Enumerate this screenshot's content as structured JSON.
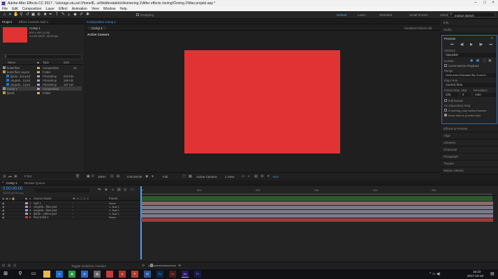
{
  "window": {
    "title": "Adobe After Effects CC 2017 - \\\\storage.stu.sel.\\Home$\\...a\\Webbredaktör\\Animering 2\\After effects övning\\Övning 2\\Mas projekt.aep *"
  },
  "menu": [
    "File",
    "Edit",
    "Composition",
    "Layer",
    "Effect",
    "Animation",
    "View",
    "Window",
    "Help"
  ],
  "toolbar": {
    "snapping_label": "Snapping",
    "workspaces": [
      "Default",
      "Learn",
      "Standard",
      "Small Screen",
      "Libraries"
    ],
    "search_value": "motion sketch"
  },
  "project": {
    "tab_project": "Project",
    "tab_effect_controls": "Effect Controls Null 1",
    "comp_name": "Comp 1",
    "comp_info_1": "600 x 400 (1,00)",
    "comp_info_2": "Δ 0:00:05:00, 25,00 fps",
    "search_placeholder": "",
    "columns": {
      "name": "Name",
      "type": "Type",
      "size": "Size"
    },
    "items": [
      {
        "name": "butterflie2",
        "type": "Composition",
        "size": "",
        "extra": "25"
      },
      {
        "name": "butterflie2 Layers",
        "type": "Folder",
        "size": "",
        "extra": ""
      },
      {
        "name": "fjäril2...lie2.psd",
        "type": "Photoshop",
        "size": "210 KB",
        "extra": ""
      },
      {
        "name": "vingesk...2.psd",
        "type": "Photoshop",
        "size": "185 KB",
        "extra": ""
      },
      {
        "name": "vingesk...2.psd",
        "type": "Photoshop",
        "size": "187 KB",
        "extra": ""
      },
      {
        "name": "Comp 1",
        "type": "Composition",
        "size": "",
        "extra": ""
      },
      {
        "name": "fjärilis",
        "type": "Folder",
        "size": "",
        "extra": ""
      }
    ],
    "bpc": "8 bpc"
  },
  "composition": {
    "tab_label": "Composition Comp 1",
    "comp_tab": "Comp 1",
    "active_camera": "Active Camera",
    "renderer_label": "Renderer:",
    "renderer_value": "Classic 3D",
    "zoom": "100%",
    "timecode": "0:00:00:00",
    "quality": "Full",
    "camera_select": "Active Camera",
    "view_select": "1 View",
    "offset": "+0,0",
    "solid_color": "#e13333"
  },
  "right_panels": {
    "top": [
      "Info",
      "Audio"
    ],
    "preview": {
      "title": "Preview",
      "shortcut_label": "Shortcut",
      "shortcut_value": "Spacebar",
      "include_label": "Include:",
      "cache_before": "Cache Before Playback",
      "range_label": "Range",
      "range_value": "Work Area Extended By Current...",
      "play_from_label": "Play From",
      "play_from_value": "Current Time",
      "frame_rate_label": "Frame Rate",
      "skip_label": "Skip",
      "resolution_label": "Resolution",
      "frame_rate_value": "(25)",
      "skip_value": "0",
      "resolution_value": "Auto",
      "full_screen": "Full Screen",
      "on_stop_label": "On (Spacebar) Stop:",
      "if_caching": "If caching, play cached frames",
      "move_time": "Move time to preview time"
    },
    "bottom": [
      "Effects & Presets",
      "Align",
      "Libraries",
      "Character",
      "Paragraph",
      "Tracker",
      "Motion Sketch"
    ]
  },
  "timeline": {
    "tab_comp": "Comp 1",
    "tab_render": "Render Queue",
    "timecode": "0:00:00:00",
    "fps": "00000 (25.00 fps)",
    "header": {
      "source_name": "Source Name",
      "parent": "Parent"
    },
    "ruler": [
      "0s",
      "01s",
      "02s",
      "03s",
      "04s",
      "05s"
    ],
    "layers": [
      {
        "num": "1",
        "name": "Null 1",
        "parent": "None",
        "color": "#c8a0a0",
        "bar": "#8d6b6b"
      },
      {
        "num": "2",
        "name": "vingesk...flie2.psd",
        "parent": "1. Null 1",
        "color": "#a99acf",
        "bar": "#7a7a8a"
      },
      {
        "num": "3",
        "name": "vingesk...flie2.psd",
        "parent": "1. Null 1",
        "color": "#a99acf",
        "bar": "#7a7a8a"
      },
      {
        "num": "4",
        "name": "fjäril2...erflie2.psd",
        "parent": "1. Null 1",
        "color": "#a99acf",
        "bar": "#7a7a8a"
      },
      {
        "num": "5",
        "name": "Red Solid 1",
        "parent": "None",
        "color": "#e13333",
        "bar": "#9e3b3b"
      }
    ],
    "toggle_label": "Toggle Switches / Modes"
  },
  "taskbar": {
    "time": "15:23",
    "date": "2017-10-10"
  }
}
